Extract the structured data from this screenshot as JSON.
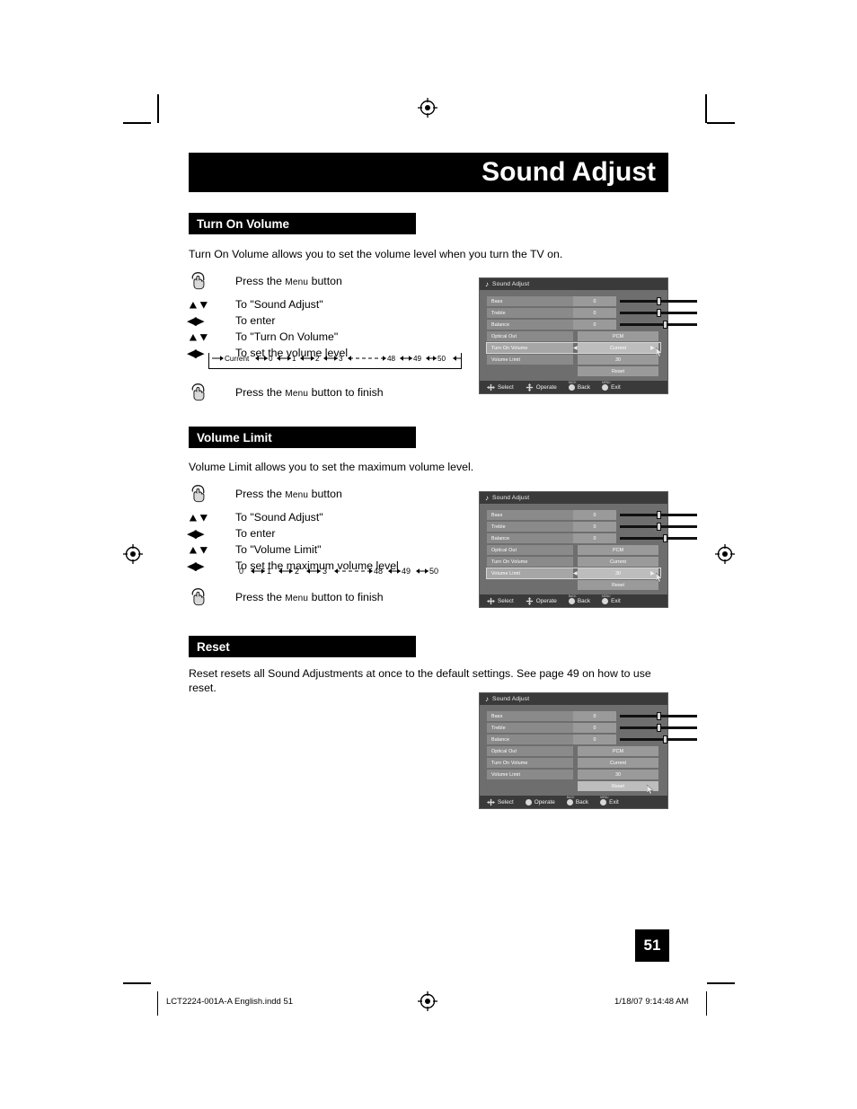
{
  "page": {
    "title": "Sound Adjust",
    "number": "51"
  },
  "sections": [
    {
      "heading": "Turn On Volume",
      "intro": "Turn On Volume allows you to set the volume level when you turn the TV on.",
      "steps": [
        {
          "key": "hand-icon",
          "label_pre": "Press the ",
          "label_sc": "Menu",
          "label_post": " button"
        },
        {
          "key": "updown",
          "label": "To \"Sound Adjust\""
        },
        {
          "key": "leftright",
          "label": "To enter"
        },
        {
          "key": "updown",
          "label": "To \"Turn On Volume\""
        },
        {
          "key": "leftright",
          "label": "To set the volume level"
        }
      ],
      "value_loop": "Current      0      1      2      3                48      49      50",
      "value_loop_items": [
        "Current",
        "0",
        "1",
        "2",
        "3",
        "48",
        "49",
        "50"
      ],
      "finish_pre": "Press the ",
      "finish_sc": "Menu",
      "finish_post": " button to finish"
    },
    {
      "heading": "Volume Limit",
      "intro": "Volume Limit allows you to set the maximum volume level.",
      "steps": [
        {
          "key": "hand-icon",
          "label_pre": "Press the ",
          "label_sc": "Menu",
          "label_post": " button"
        },
        {
          "key": "updown",
          "label": "To \"Sound Adjust\""
        },
        {
          "key": "leftright",
          "label": "To enter"
        },
        {
          "key": "updown",
          "label": "To \"Volume Limit\""
        },
        {
          "key": "leftright",
          "label": "To set the maximum volume level"
        }
      ],
      "value_loop_items": [
        "0",
        "1",
        "2",
        "3",
        "48",
        "49",
        "50"
      ],
      "finish_pre": "Press the ",
      "finish_sc": "Menu",
      "finish_post": " button to finish"
    },
    {
      "heading": "Reset",
      "intro": "Reset resets all Sound Adjustments at once to the default settings.  See page 49 on how to use reset."
    }
  ],
  "osd": {
    "title": "Sound Adjust",
    "music_note": "♪",
    "rows": [
      {
        "name": "Bass",
        "value": "0",
        "type": "slider",
        "knob_pct": 50
      },
      {
        "name": "Treble",
        "value": "0",
        "type": "slider",
        "knob_pct": 50
      },
      {
        "name": "Balance",
        "value": "0",
        "type": "slider",
        "knob_pct": 58
      },
      {
        "name": "Optical Out",
        "value": "PCM",
        "type": "wide"
      },
      {
        "name": "Turn On Volume",
        "value": "Current",
        "type": "wide"
      },
      {
        "name": "Volume Limit",
        "value": "30",
        "type": "wide"
      }
    ],
    "reset_label": "Reset",
    "caret_left": "◀",
    "caret_right": "▶",
    "footer": [
      {
        "label": "Select",
        "icon": "dpad-lr-icon",
        "cap": ""
      },
      {
        "label": "Operate",
        "icon": "dpad-ud-icon",
        "cap": ""
      },
      {
        "label": "Back",
        "icon": "circle-button-icon",
        "cap": "BACK"
      },
      {
        "label": "Exit",
        "icon": "circle-button-icon",
        "cap": "MENU"
      }
    ],
    "selected": [
      "Turn On Volume",
      "Volume Limit",
      "Reset"
    ]
  },
  "footer": {
    "file": "LCT2224-001A-A English.indd   51",
    "timestamp": "1/18/07   9:14:48 AM"
  },
  "glyphs": {
    "up_down": "▲▼",
    "left_right": "◀▶"
  }
}
